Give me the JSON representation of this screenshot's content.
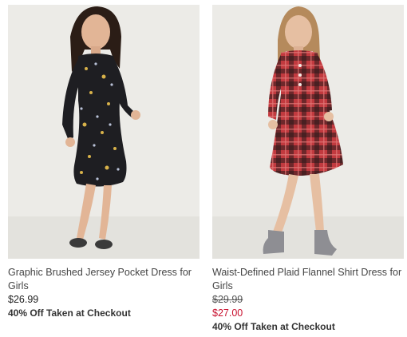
{
  "products": [
    {
      "title": "Graphic Brushed Jersey Pocket Dress for Girls",
      "price": "$26.99",
      "promo": "40% Off Taken at Checkout"
    },
    {
      "title": "Waist-Defined Plaid Flannel Shirt Dress for Girls",
      "original_price": "$29.99",
      "sale_price": "$27.00",
      "promo": "40% Off Taken at Checkout"
    }
  ],
  "colors": {
    "sale_price": "#c8102e",
    "photo_background": "#e9e8e4"
  }
}
